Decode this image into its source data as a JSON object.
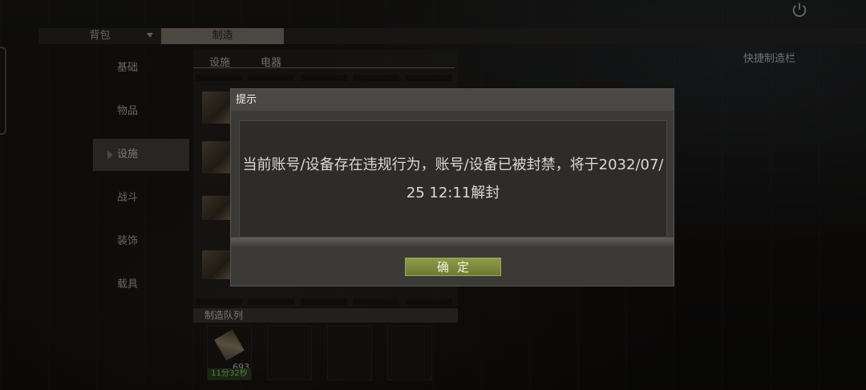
{
  "top_tabs": [
    {
      "label": "背包",
      "active": false
    },
    {
      "label": "制造",
      "active": true
    }
  ],
  "quick_bar_label": "快捷制造栏",
  "sidebar": {
    "items": [
      {
        "label": "基础",
        "active": false
      },
      {
        "label": "物品",
        "active": false
      },
      {
        "label": "设施",
        "active": true
      },
      {
        "label": "战斗",
        "active": false
      },
      {
        "label": "装饰",
        "active": false
      },
      {
        "label": "载具",
        "active": false
      }
    ]
  },
  "sub_tabs": [
    "设施",
    "电器"
  ],
  "queue": {
    "title": "制造队列",
    "item_count": "693",
    "item_time": "11分32秒"
  },
  "modal": {
    "title": "提示",
    "message": "当前账号/设备存在违规行为，账号/设备已被封禁，将于2032/07/25 12:11解封",
    "confirm_label": "确定"
  },
  "colors": {
    "confirm_button": "#7d8a3e",
    "active_tab": "#8a8275"
  },
  "icons": [
    "power-icon"
  ]
}
